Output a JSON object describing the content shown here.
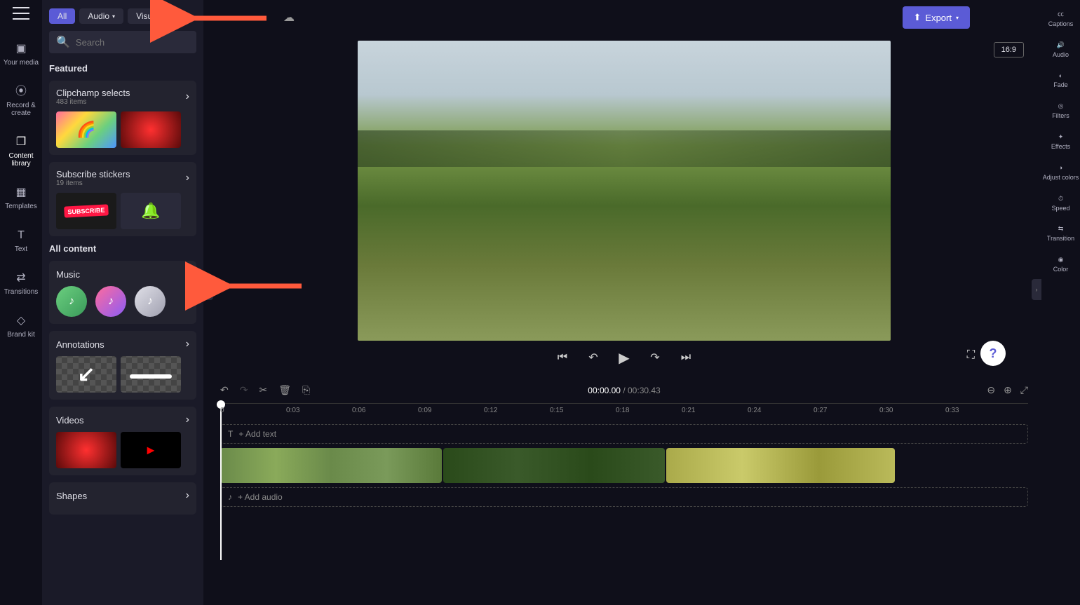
{
  "leftRail": {
    "items": [
      {
        "label": "Your media"
      },
      {
        "label": "Record & create"
      },
      {
        "label": "Content library"
      },
      {
        "label": "Templates"
      },
      {
        "label": "Text"
      },
      {
        "label": "Transitions"
      },
      {
        "label": "Brand kit"
      }
    ]
  },
  "chips": {
    "all": "All",
    "audio": "Audio",
    "visuals": "Visuals"
  },
  "search": {
    "placeholder": "Search"
  },
  "sections": {
    "featured": "Featured",
    "allContent": "All content"
  },
  "cards": {
    "selects": {
      "title": "Clipchamp selects",
      "sub": "483 items"
    },
    "stickers": {
      "title": "Subscribe stickers",
      "sub": "19 items"
    },
    "music": {
      "title": "Music"
    },
    "annotations": {
      "title": "Annotations"
    },
    "videos": {
      "title": "Videos"
    },
    "shapes": {
      "title": "Shapes"
    }
  },
  "header": {
    "export": "Export",
    "aspect": "16:9"
  },
  "rightRail": {
    "items": [
      {
        "label": "Captions"
      },
      {
        "label": "Audio"
      },
      {
        "label": "Fade"
      },
      {
        "label": "Filters"
      },
      {
        "label": "Effects"
      },
      {
        "label": "Adjust colors"
      },
      {
        "label": "Speed"
      },
      {
        "label": "Transition"
      },
      {
        "label": "Color"
      }
    ]
  },
  "timeline": {
    "current": "00:00.00",
    "total": "00:30.43",
    "sep": " / ",
    "addText": "+ Add text",
    "addAudio": "+ Add audio",
    "ticks": [
      "0",
      "0:03",
      "0:06",
      "0:09",
      "0:12",
      "0:15",
      "0:18",
      "0:21",
      "0:24",
      "0:27",
      "0:30",
      "0:33"
    ]
  },
  "help": "?"
}
